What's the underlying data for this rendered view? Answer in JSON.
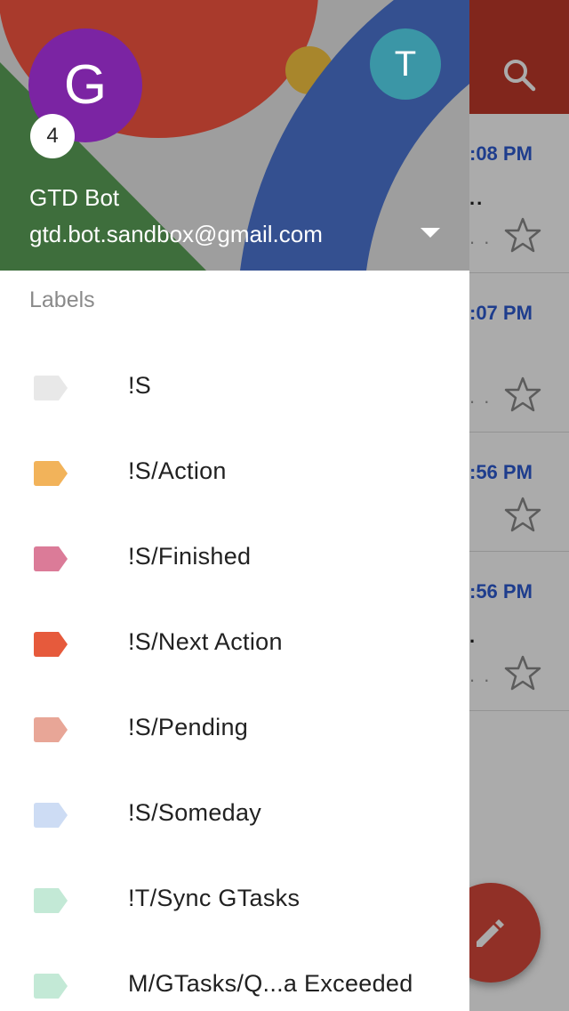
{
  "inbox": {
    "rows": [
      {
        "time": ":08 PM",
        "snippet": "..",
        "snippet2": ". ."
      },
      {
        "time": ":07 PM",
        "snippet": "",
        "snippet2": ". ."
      },
      {
        "time": ":56 PM",
        "snippet": "",
        "snippet2": ""
      },
      {
        "time": ":56 PM",
        "snippet": ".",
        "snippet2": ". ."
      }
    ]
  },
  "account": {
    "avatar_letter": "G",
    "badge_count": "4",
    "alt_avatar_letter": "T",
    "name": "GTD Bot",
    "email": "gtd.bot.sandbox@gmail.com"
  },
  "labels_section": {
    "title": "Labels",
    "items": [
      {
        "label": "!S",
        "color": "#e8e8e8"
      },
      {
        "label": "!S/Action",
        "color": "#f2b35a"
      },
      {
        "label": "!S/Finished",
        "color": "#db7b98"
      },
      {
        "label": "!S/Next Action",
        "color": "#e65a3c"
      },
      {
        "label": "!S/Pending",
        "color": "#e8a697"
      },
      {
        "label": "!S/Someday",
        "color": "#cddcf4"
      },
      {
        "label": "!T/Sync GTasks",
        "color": "#c3e9d6"
      },
      {
        "label": "M/GTasks/Q...a Exceeded",
        "color": "#c3e9d6"
      }
    ]
  },
  "colors": {
    "header_red": "#c0392b",
    "accent_blue": "#2d5bd3",
    "fab_red": "#d9483b",
    "avatar_purple": "#7b24a3",
    "avatar_teal": "#3b96a6"
  }
}
